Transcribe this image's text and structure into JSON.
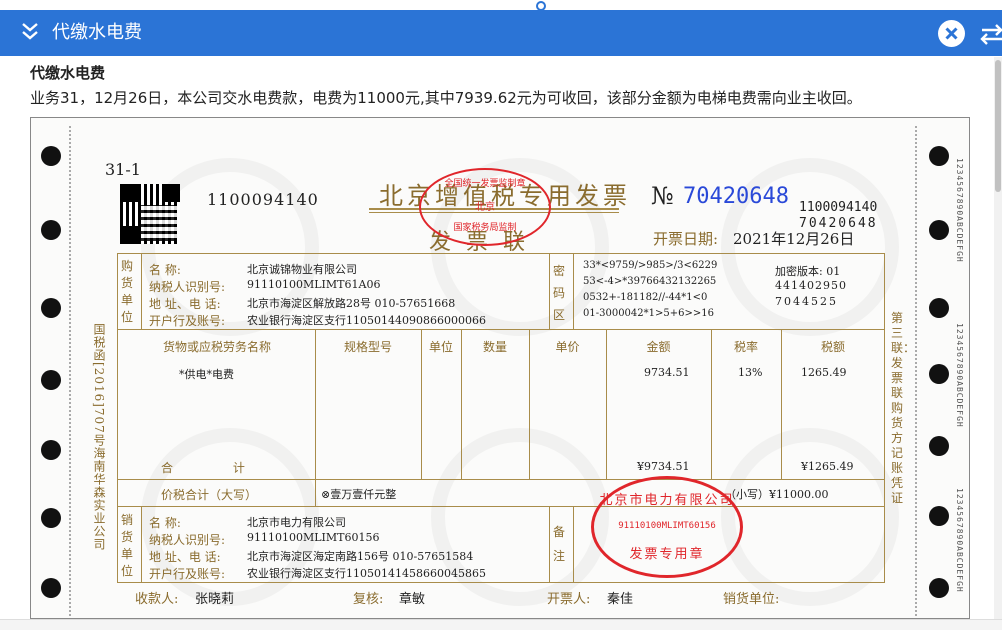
{
  "window": {
    "title": "代缴水电费"
  },
  "section": {
    "title": "代缴水电费",
    "description": "业务31，12月26日，本公司交水电费款，电费为11000元,其中7939.62元为可收回，该部分金额为电梯电费需向业主收回。"
  },
  "invoice": {
    "doc_no": "31-1",
    "invoice_code": "1100094140",
    "title": "北京增值税专用发票",
    "subtitle": "发 票 联",
    "no_symbol": "№",
    "invoice_number": "70420648",
    "right_code": "1100094140",
    "right_number": "70420648",
    "issue_date_label": "开票日期:",
    "issue_date": "2021年12月26日",
    "left_margin_text": "国税函[2016]707号海南华森实业公司",
    "right_margin_text": "第三联：发票联 购货方记账凭证",
    "side_code": "1234567890ABCDEFGH",
    "buyer": {
      "section_label": "购货单位",
      "name_label": "名 称:",
      "name": "北京诚锦物业有限公司",
      "tax_id_label": "纳税人识别号:",
      "tax_id": "91110100MLIMT61A06",
      "address_label": "地 址、电 话:",
      "address": "北京市海淀区解放路28号 010-57651668",
      "bank_label": "开户行及账号:",
      "bank": "农业银行海淀区支行11050144090866000066"
    },
    "cipher": {
      "label": "密码区",
      "lines": [
        "33*<9759/>985>/3<6229",
        "53<-4>*39766432132265",
        "0532+-181182//-44*1<0",
        "01-3000042*1>5+6>>16"
      ],
      "version_label": "加密版本: 01",
      "code1": "441402950",
      "code2": "7044525"
    },
    "columns": [
      "货物或应税劳务名称",
      "规格型号",
      "单位",
      "数量",
      "单价",
      "金额",
      "税率",
      "税额"
    ],
    "item": {
      "name": "*供电*电费",
      "amount": "9734.51",
      "tax_rate": "13%",
      "tax": "1265.49"
    },
    "total_label": "合 计",
    "total_amount": "¥9734.51",
    "total_tax": "¥1265.49",
    "grand_total_label": "价税合计（大写）",
    "grand_total_words": "⊗壹万壹仟元整",
    "grand_total_small": "（小写）¥11000.00",
    "seller": {
      "section_label": "销货单位",
      "name_label": "名 称:",
      "name": "北京市电力有限公司",
      "tax_id_label": "纳税人识别号:",
      "tax_id": "91110100MLIMT60156",
      "address_label": "地 址、电 话:",
      "address": "北京市海淀区海定南路156号 010-57651584",
      "bank_label": "开户行及账号:",
      "bank": "农业银行海淀区支行11050141458660045865"
    },
    "remark_label": "备注",
    "seal": {
      "org": "北京市电力有限公司",
      "tax_id": "91110100MLIMT60156",
      "text": "发票专用章"
    },
    "tax_seal": {
      "text_top": "全国统一发票监制章",
      "text_mid": "北京",
      "text_bottom": "国家税务局监制"
    },
    "footer": {
      "payee_label": "收款人:",
      "payee": "张晓莉",
      "reviewer_label": "复核:",
      "reviewer": "章敏",
      "drawer_label": "开票人:",
      "drawer": "秦佳",
      "seller_label": "销货单位:"
    }
  }
}
